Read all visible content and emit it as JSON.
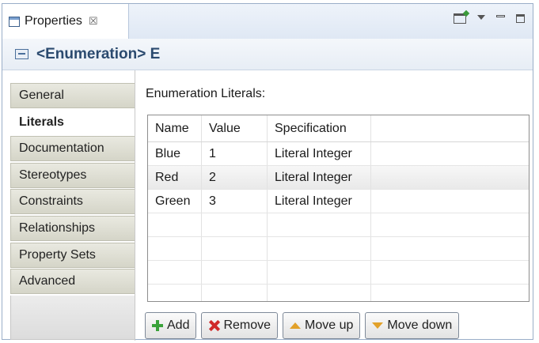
{
  "view": {
    "tab_label": "Properties",
    "close_glyph": "☒",
    "title": "<Enumeration> E"
  },
  "sidebar": {
    "tabs": [
      {
        "label": "General"
      },
      {
        "label": "Literals"
      },
      {
        "label": "Documentation"
      },
      {
        "label": "Stereotypes"
      },
      {
        "label": "Constraints"
      },
      {
        "label": "Relationships"
      },
      {
        "label": "Property Sets"
      },
      {
        "label": "Advanced"
      }
    ],
    "active": "Literals"
  },
  "literals": {
    "section_label": "Enumeration Literals:",
    "columns": [
      "Name",
      "Value",
      "Specification"
    ],
    "rows": [
      [
        "Blue",
        "1",
        "Literal Integer"
      ],
      [
        "Red",
        "2",
        "Literal Integer"
      ],
      [
        "Green",
        "3",
        "Literal Integer"
      ]
    ],
    "selected_row": 1
  },
  "buttons": {
    "add": "Add",
    "remove": "Remove",
    "move_up": "Move up",
    "move_down": "Move down"
  },
  "icons": {
    "tab": "properties-icon",
    "header": "enumeration-icon",
    "add": "plus-icon",
    "remove": "x-icon",
    "move_up": "arrow-up-icon",
    "move_down": "arrow-down-icon"
  }
}
